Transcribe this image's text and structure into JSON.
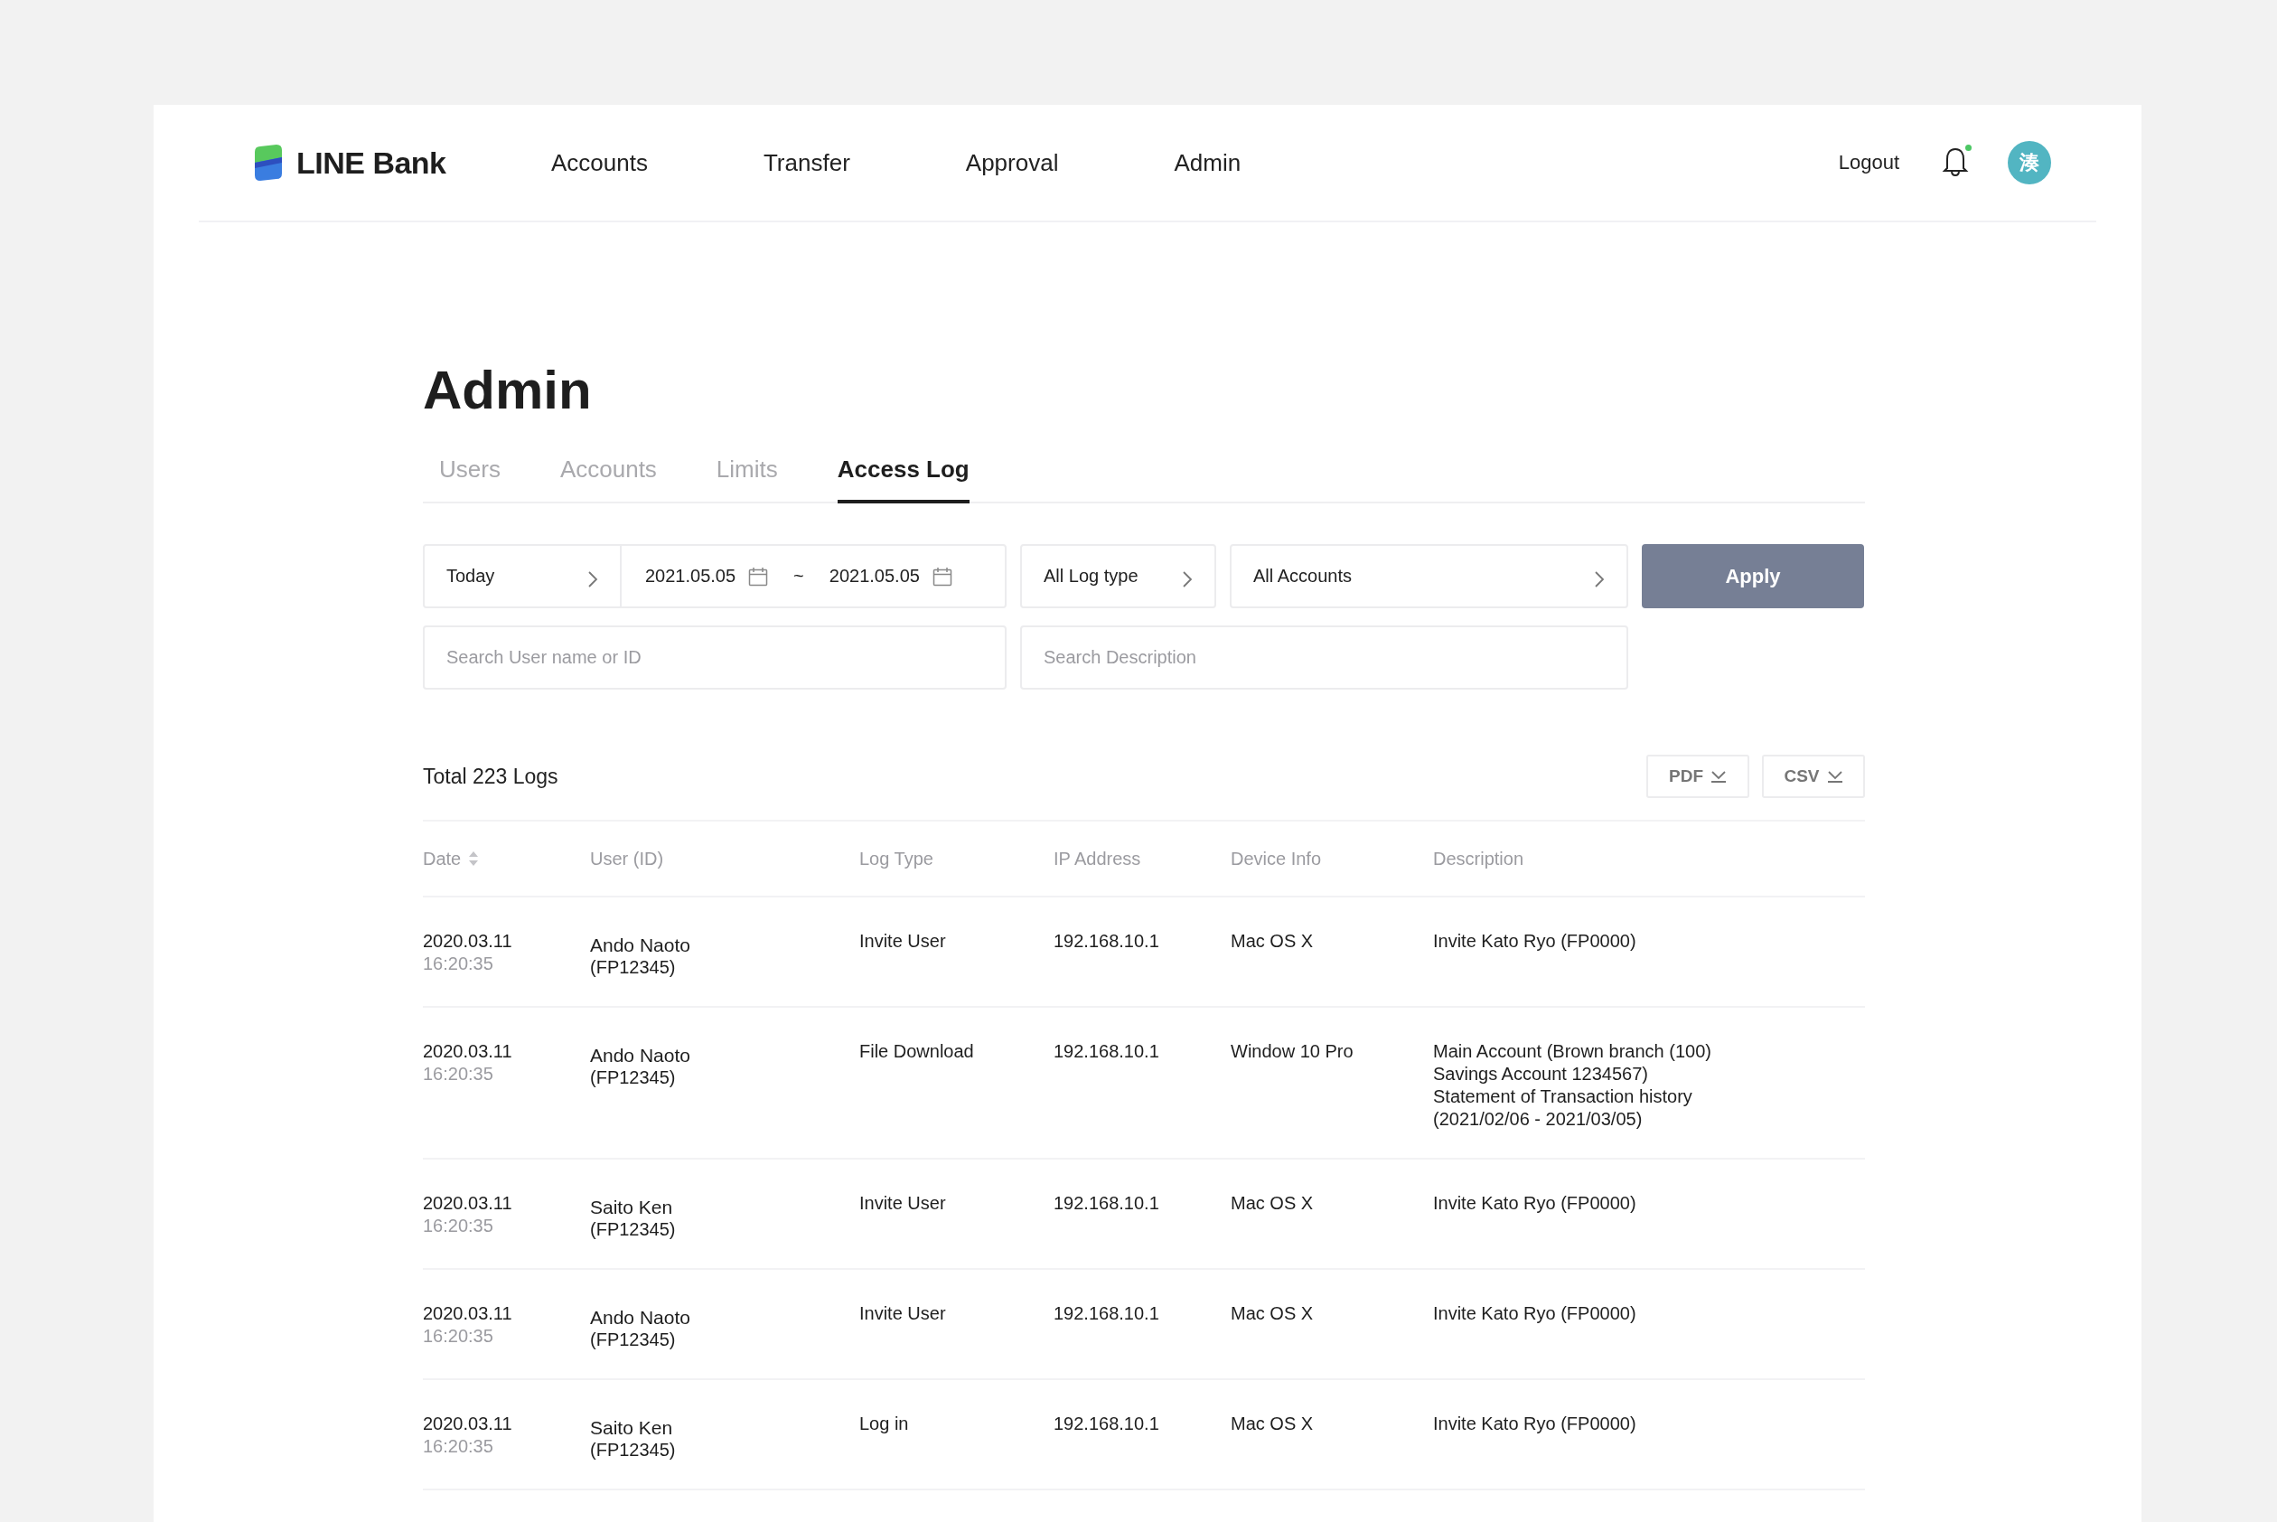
{
  "header": {
    "brand": "LINE Bank",
    "nav": [
      {
        "label": "Accounts"
      },
      {
        "label": "Transfer"
      },
      {
        "label": "Approval"
      },
      {
        "label": "Admin"
      }
    ],
    "logout": "Logout",
    "notification_unread": true,
    "avatar": "湊"
  },
  "page_title": "Admin",
  "tabs": [
    {
      "label": "Users",
      "selected": false
    },
    {
      "label": "Accounts",
      "selected": false
    },
    {
      "label": "Limits",
      "selected": false
    },
    {
      "label": "Access Log",
      "selected": true
    }
  ],
  "filters": {
    "period": "Today",
    "date_from": "2021.05.05",
    "separator": "~",
    "date_to": "2021.05.05",
    "log_type": "All Log type",
    "account": "All Accounts",
    "apply": "Apply",
    "search_user": {
      "placeholder": "Search User name or ID"
    },
    "search_description": {
      "placeholder": "Search Description"
    }
  },
  "summary": "Total 223 Logs",
  "exports": [
    {
      "label": "PDF"
    },
    {
      "label": "CSV"
    }
  ],
  "table": {
    "columns": [
      {
        "label": "Date",
        "sortable": true
      },
      {
        "label": "User (ID)",
        "sortable": false
      },
      {
        "label": "Log Type",
        "sortable": false
      },
      {
        "label": "IP Address",
        "sortable": false
      },
      {
        "label": "Device Info",
        "sortable": false
      },
      {
        "label": "Description",
        "sortable": false
      }
    ],
    "rows": [
      {
        "date": "2020.03.11",
        "time": "16:20:35",
        "user": "Ando Naoto",
        "user_id": "(FP12345)",
        "log_type": "Invite User",
        "ip": "192.168.10.1",
        "device": "Mac OS X",
        "description": "Invite Kato Ryo (FP0000)"
      },
      {
        "date": "2020.03.11",
        "time": "16:20:35",
        "user": "Ando Naoto",
        "user_id": "(FP12345)",
        "log_type": "File Download",
        "ip": "192.168.10.1",
        "device": "Window 10 Pro",
        "description": "Main Account (Brown branch (100)\nSavings Account 1234567)\nStatement of Transaction history\n(2021/02/06 - 2021/03/05)"
      },
      {
        "date": "2020.03.11",
        "time": "16:20:35",
        "user": "Saito Ken",
        "user_id": "(FP12345)",
        "log_type": "Invite User",
        "ip": "192.168.10.1",
        "device": "Mac OS X",
        "description": "Invite Kato Ryo (FP0000)"
      },
      {
        "date": "2020.03.11",
        "time": "16:20:35",
        "user": "Ando Naoto",
        "user_id": "(FP12345)",
        "log_type": "Invite User",
        "ip": "192.168.10.1",
        "device": "Mac OS X",
        "description": "Invite Kato Ryo (FP0000)"
      },
      {
        "date": "2020.03.11",
        "time": "16:20:35",
        "user": "Saito Ken",
        "user_id": "(FP12345)",
        "log_type": "Log in",
        "ip": "192.168.10.1",
        "device": "Mac OS X",
        "description": "Invite Kato Ryo (FP0000)"
      }
    ]
  }
}
